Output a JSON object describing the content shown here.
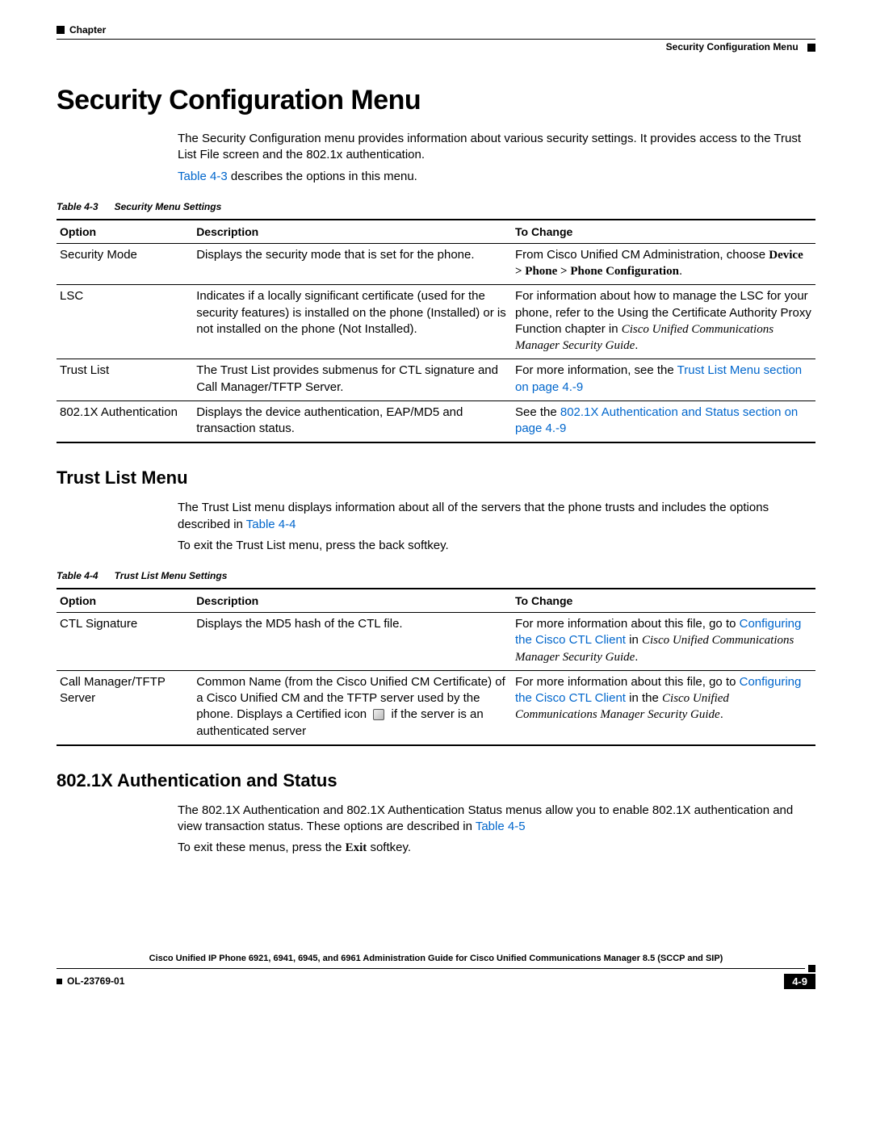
{
  "header": {
    "chapter_label": "Chapter",
    "breadcrumb": "Security Configuration Menu"
  },
  "title": "Security Configuration Menu",
  "intro": {
    "p1": "The Security Configuration menu provides information about various security settings. It provides access to the Trust List File screen and the 802.1x authentication.",
    "p2_pre": "",
    "p2_link": "Table 4-3",
    "p2_post": " describes the options in this menu."
  },
  "table43": {
    "caption_num": "Table 4-3",
    "caption_title": "Security Menu Settings",
    "headers": {
      "opt": "Option",
      "desc": "Description",
      "change": "To Change"
    },
    "rows": [
      {
        "opt": "Security Mode",
        "desc": "Displays the security mode that is set for the phone.",
        "change_pre": "From Cisco Unified CM Administration, choose ",
        "change_bold": "Device > Phone > Phone Configuration",
        "change_post": "."
      },
      {
        "opt": "LSC",
        "desc": "Indicates if a locally significant certificate (used for the security features) is installed on the phone (Installed) or is not installed on the phone (Not Installed).",
        "change_pre": "For information about how to manage the LSC for your phone, refer to the  Using the Certificate Authority Proxy Function  chapter in ",
        "change_italic": "Cisco Unified Communications Manager Security Guide",
        "change_post": "."
      },
      {
        "opt": "Trust List",
        "desc": "The Trust List provides submenus for CTL signature and Call Manager/TFTP Server.",
        "change_pre": "For more information, see the ",
        "change_link": "Trust List Menu section on page 4.-9",
        "change_post": ""
      },
      {
        "opt": "802.1X Authentication",
        "desc": "Displays the device authentication, EAP/MD5 and transaction status.",
        "change_pre": "See the ",
        "change_link": "802.1X Authentication and Status section on page 4.-9",
        "change_post": ""
      }
    ]
  },
  "trustlist": {
    "heading": "Trust List Menu",
    "p1_pre": "The Trust List menu displays information about all of the servers that the phone trusts and includes the options described in ",
    "p1_link": "Table 4-4",
    "p2": "To exit the Trust List menu, press the back softkey."
  },
  "table44": {
    "caption_num": "Table 4-4",
    "caption_title": "Trust List Menu Settings",
    "headers": {
      "opt": "Option",
      "desc": "Description",
      "change": "To Change"
    },
    "rows": [
      {
        "opt": "CTL Signature",
        "desc": "Displays the MD5 hash of the CTL file.",
        "change_pre": "For more information about this file, go to ",
        "change_link": "Configuring the Cisco CTL Client",
        "change_mid": " in ",
        "change_italic": "Cisco Unified Communications Manager Security Guide",
        "change_post": "."
      },
      {
        "opt": "Call Manager/TFTP Server",
        "desc_pre": "Common Name (from the Cisco Unified CM Certificate) of a Cisco Unified CM and the TFTP server used by the phone. Displays a Certified icon ",
        "desc_post": " if the server is an authenticated server",
        "change_pre": "For more information about this file, go to ",
        "change_link": "Configuring the Cisco CTL Client",
        "change_mid": " in the ",
        "change_italic": "Cisco Unified Communications Manager Security Guide",
        "change_post": "."
      }
    ]
  },
  "auth": {
    "heading": "802.1X Authentication and Status",
    "p1_pre": "The 802.1X Authentication and 802.1X Authentication Status menus allow you to enable 802.1X authentication and view transaction status. These options are described in ",
    "p1_link": "Table 4-5",
    "p2_pre": "To exit these menus, press the ",
    "p2_bold": "Exit",
    "p2_post": " softkey."
  },
  "footer": {
    "title": "Cisco Unified IP Phone 6921, 6941, 6945, and 6961 Administration Guide for Cisco Unified Communications Manager 8.5 (SCCP and SIP)",
    "doc_id": "OL-23769-01",
    "page_num": "4-9"
  }
}
